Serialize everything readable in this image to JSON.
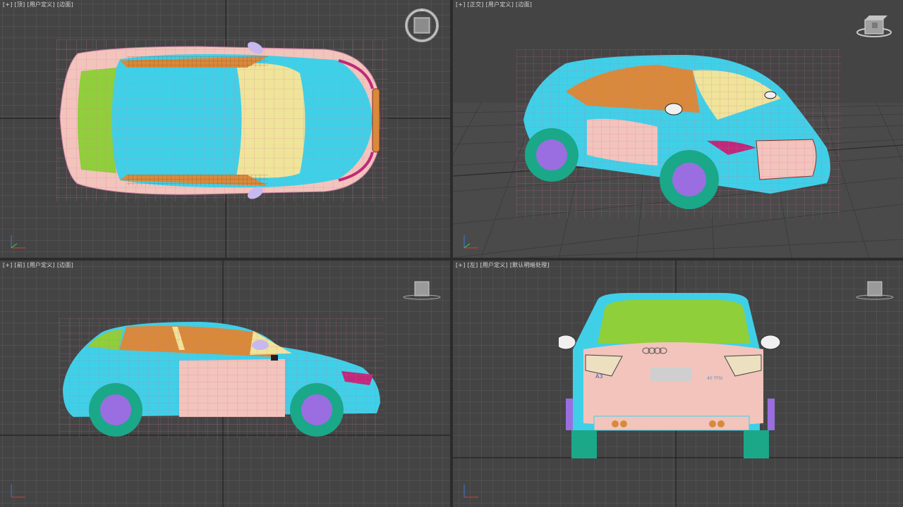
{
  "viewports": {
    "top": {
      "labels": [
        "[+]",
        "[顶]",
        "[用户定义]",
        "[边面]"
      ]
    },
    "persp": {
      "labels": [
        "[+]",
        "[正交]",
        "[用户定义]",
        "[边面]"
      ]
    },
    "front": {
      "labels": [
        "[+]",
        "[前]",
        "[用户定义]",
        "[边面]"
      ]
    },
    "left": {
      "labels": [
        "[+]",
        "[左]",
        "[用户定义]",
        "[默认明暗处理]"
      ]
    }
  },
  "car": {
    "brand_text": "A3",
    "badge_text": "40 TFSI"
  },
  "colors": {
    "viewport_bg": "#444444",
    "grid_line": "#5a5a5a",
    "grid_major": "#222222",
    "active_border": "#c8a830",
    "body_cyan": "#3fd0e8",
    "body_pink": "#f2c4bc",
    "glass_yellow": "#efe49a",
    "glass_green": "#8fcf3a",
    "window_orange": "#d88a3a",
    "wheel_teal": "#1aa889",
    "rim_purple": "#9a6ee0",
    "trim_magenta": "#c0287a"
  },
  "icons": [
    "viewcube-icon",
    "axis-tripod-icon",
    "viewport-home-icon"
  ]
}
